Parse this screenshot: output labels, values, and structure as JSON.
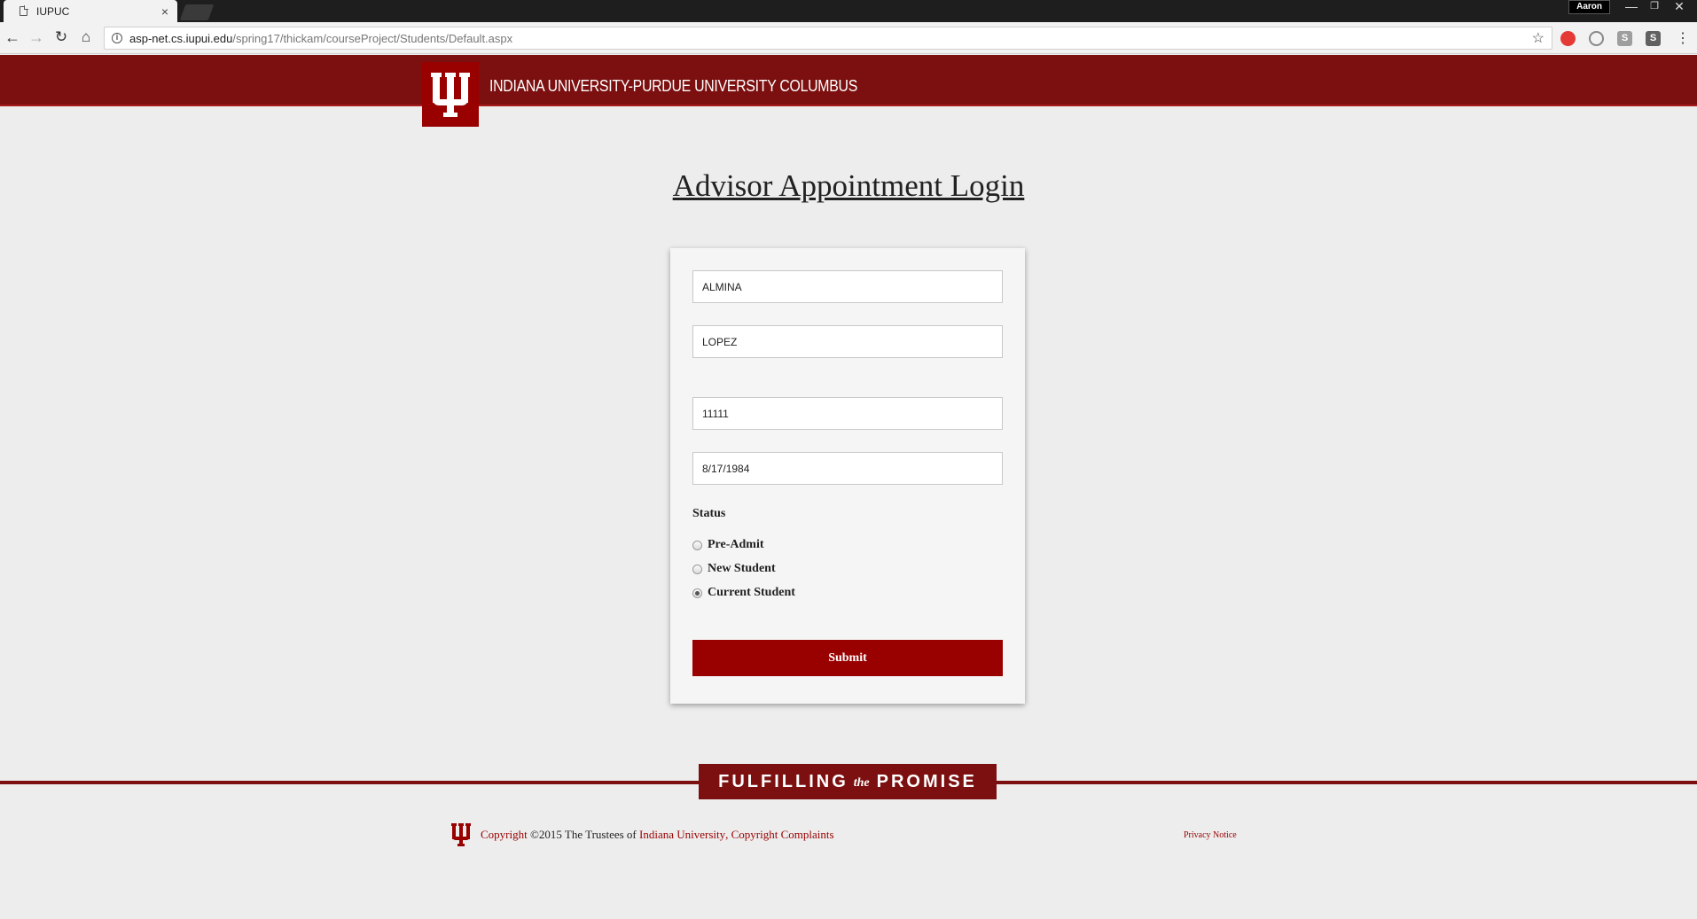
{
  "browser": {
    "tab_title": "IUPUC",
    "tab_close": "×",
    "user_name": "Aaron",
    "url_host": "asp-net.cs.iupui.edu",
    "url_path": "/spring17/thickam/courseProject/Students/Default.aspx"
  },
  "header": {
    "university_name": "INDIANA UNIVERSITY-PURDUE UNIVERSITY COLUMBUS"
  },
  "page": {
    "title": "Advisor Appointment Login"
  },
  "form": {
    "first_name": "ALMINA",
    "last_name": "LOPEZ",
    "student_id": "11111",
    "birth_date": "8/17/1984",
    "status_label": "Status",
    "status_options": [
      "Pre-Admit",
      "New Student",
      "Current Student"
    ],
    "selected_status": "Current Student",
    "submit_label": "Submit"
  },
  "footer": {
    "promise_left": "FULFILLING",
    "promise_the": "the",
    "promise_right": "PROMISE",
    "copyright_prefix": "Copyright",
    "copyright_middle": "©2015 The Trustees of",
    "indiana_university_link": "Indiana University",
    "copyright_complaints_link": "Copyright Complaints",
    "privacy_notice_link": "Privacy Notice"
  },
  "colors": {
    "brand_crimson": "#990000",
    "header_bar": "#7c1010",
    "page_background": "#ededed"
  }
}
